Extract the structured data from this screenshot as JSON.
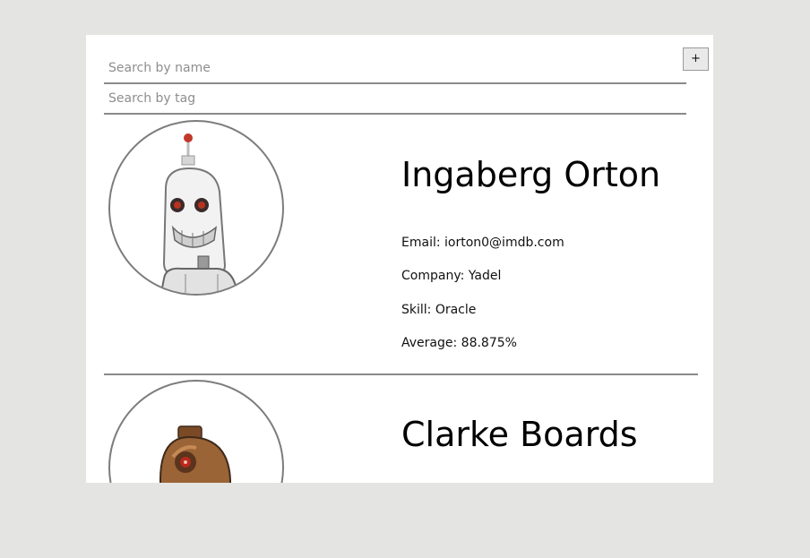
{
  "search": {
    "name_placeholder": "Search by name",
    "tag_placeholder": "Search by tag"
  },
  "expand_button": "+",
  "students": [
    {
      "name": "Ingaberg Orton",
      "email": "Email: iorton0@imdb.com",
      "company": "Company: Yadel",
      "skill": "Skill: Oracle",
      "average": "Average: 88.875%",
      "avatar_icon": "white-robot-avatar"
    },
    {
      "name": "Clarke Boards",
      "avatar_icon": "brown-robot-avatar"
    }
  ],
  "colors": {
    "page_background": "#e4e4e3",
    "card_background": "#ffffff",
    "divider": "#8a8a8a",
    "avatar_border": "#7c7c7c"
  }
}
